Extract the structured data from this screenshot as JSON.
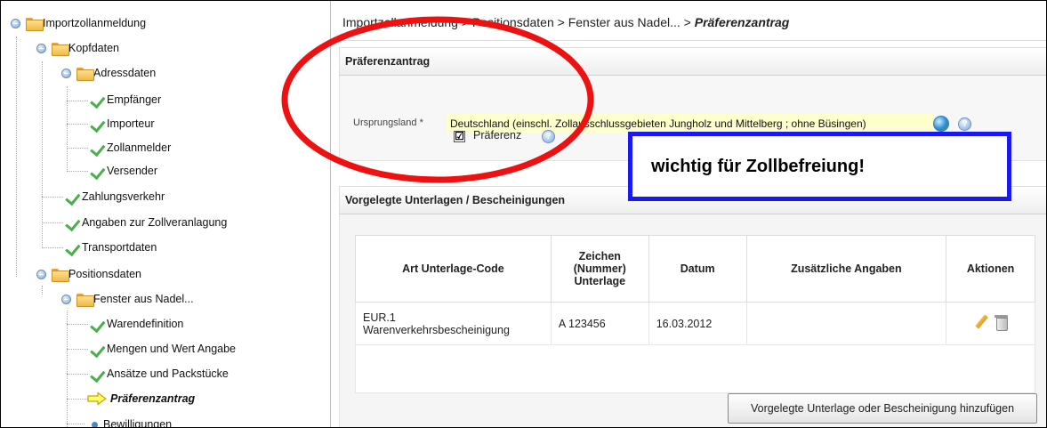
{
  "tree": {
    "items": [
      {
        "label": "Importzollanmeldung",
        "type": "folder"
      },
      {
        "label": "Kopfdaten",
        "type": "folder"
      },
      {
        "label": "Adressdaten",
        "type": "folder"
      },
      {
        "label": "Empfänger",
        "type": "check"
      },
      {
        "label": "Importeur",
        "type": "check"
      },
      {
        "label": "Zollanmelder",
        "type": "check"
      },
      {
        "label": "Versender",
        "type": "check"
      },
      {
        "label": "Zahlungsverkehr",
        "type": "check"
      },
      {
        "label": "Angaben zur Zollveranlagung",
        "type": "check"
      },
      {
        "label": "Transportdaten",
        "type": "check"
      },
      {
        "label": "Positionsdaten",
        "type": "folder"
      },
      {
        "label": "Fenster aus Nadel...",
        "type": "folder"
      },
      {
        "label": "Warendefinition",
        "type": "check"
      },
      {
        "label": "Mengen und Wert Angabe",
        "type": "check"
      },
      {
        "label": "Ansätze und Packstücke",
        "type": "check"
      },
      {
        "label": "Präferenzantrag",
        "type": "arrow"
      },
      {
        "label": "Bewilligungen",
        "type": "dot"
      }
    ]
  },
  "breadcrumb": {
    "path": "Importzollanmeldung > Positionsdaten > Fenster aus Nadel... > ",
    "current": "Präferenzantrag"
  },
  "preference_panel": {
    "title": "Präferenzantrag",
    "origin_label": "Ursprungsland *",
    "origin_value": "Deutschland (einschl. Zollausschlussgebieten Jungholz und Mittelberg ; ohne Büsingen)",
    "preference_label": "Präferenz",
    "preference_checked": "☑"
  },
  "annotation": {
    "notice": "wichtig für Zollbefreiung!",
    "ellipse_color": "#ee1111",
    "box_color": "#1a1af0"
  },
  "documents_panel": {
    "title": "Vorgelegte Unterlagen / Bescheinigungen",
    "columns": [
      "Art Unterlage-Code",
      "Zeichen (Nummer) Unterlage",
      "Datum",
      "Zusätzliche Angaben",
      "Aktionen"
    ],
    "column_lines": {
      "zeichen_1": "Zeichen",
      "zeichen_2": "(Nummer)",
      "zeichen_3": "Unterlage"
    },
    "rows": [
      {
        "code_1": "EUR.1",
        "code_2": "Warenverkehrsbescheinigung",
        "number": "A 123456",
        "date": "16.03.2012",
        "additional": ""
      }
    ],
    "add_button": "Vorgelegte Unterlage oder Bescheinigung hinzufügen"
  }
}
